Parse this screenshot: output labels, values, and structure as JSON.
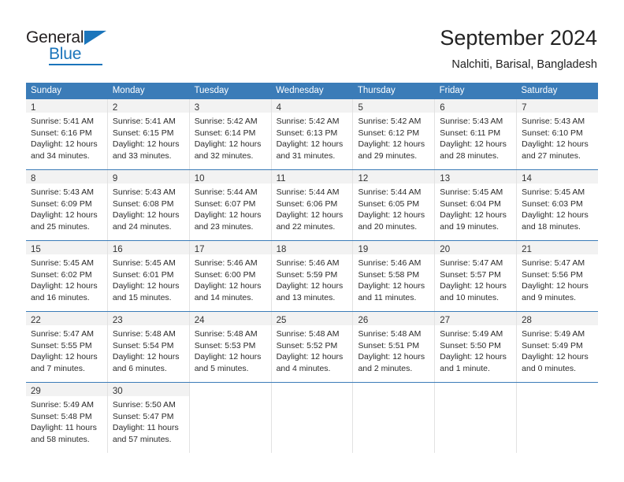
{
  "brand": {
    "name_part1": "General",
    "name_part2": "Blue"
  },
  "header": {
    "title": "September 2024",
    "location": "Nalchiti, Barisal, Bangladesh"
  },
  "weekdays": [
    "Sunday",
    "Monday",
    "Tuesday",
    "Wednesday",
    "Thursday",
    "Friday",
    "Saturday"
  ],
  "colors": {
    "header_blue": "#3b7cb8",
    "brand_blue": "#1b75bb",
    "daynum_band": "#f2f2f2",
    "cell_border": "#e2e2e2"
  },
  "weeks": [
    [
      {
        "day": "1",
        "sunrise": "Sunrise: 5:41 AM",
        "sunset": "Sunset: 6:16 PM",
        "daylight1": "Daylight: 12 hours",
        "daylight2": "and 34 minutes."
      },
      {
        "day": "2",
        "sunrise": "Sunrise: 5:41 AM",
        "sunset": "Sunset: 6:15 PM",
        "daylight1": "Daylight: 12 hours",
        "daylight2": "and 33 minutes."
      },
      {
        "day": "3",
        "sunrise": "Sunrise: 5:42 AM",
        "sunset": "Sunset: 6:14 PM",
        "daylight1": "Daylight: 12 hours",
        "daylight2": "and 32 minutes."
      },
      {
        "day": "4",
        "sunrise": "Sunrise: 5:42 AM",
        "sunset": "Sunset: 6:13 PM",
        "daylight1": "Daylight: 12 hours",
        "daylight2": "and 31 minutes."
      },
      {
        "day": "5",
        "sunrise": "Sunrise: 5:42 AM",
        "sunset": "Sunset: 6:12 PM",
        "daylight1": "Daylight: 12 hours",
        "daylight2": "and 29 minutes."
      },
      {
        "day": "6",
        "sunrise": "Sunrise: 5:43 AM",
        "sunset": "Sunset: 6:11 PM",
        "daylight1": "Daylight: 12 hours",
        "daylight2": "and 28 minutes."
      },
      {
        "day": "7",
        "sunrise": "Sunrise: 5:43 AM",
        "sunset": "Sunset: 6:10 PM",
        "daylight1": "Daylight: 12 hours",
        "daylight2": "and 27 minutes."
      }
    ],
    [
      {
        "day": "8",
        "sunrise": "Sunrise: 5:43 AM",
        "sunset": "Sunset: 6:09 PM",
        "daylight1": "Daylight: 12 hours",
        "daylight2": "and 25 minutes."
      },
      {
        "day": "9",
        "sunrise": "Sunrise: 5:43 AM",
        "sunset": "Sunset: 6:08 PM",
        "daylight1": "Daylight: 12 hours",
        "daylight2": "and 24 minutes."
      },
      {
        "day": "10",
        "sunrise": "Sunrise: 5:44 AM",
        "sunset": "Sunset: 6:07 PM",
        "daylight1": "Daylight: 12 hours",
        "daylight2": "and 23 minutes."
      },
      {
        "day": "11",
        "sunrise": "Sunrise: 5:44 AM",
        "sunset": "Sunset: 6:06 PM",
        "daylight1": "Daylight: 12 hours",
        "daylight2": "and 22 minutes."
      },
      {
        "day": "12",
        "sunrise": "Sunrise: 5:44 AM",
        "sunset": "Sunset: 6:05 PM",
        "daylight1": "Daylight: 12 hours",
        "daylight2": "and 20 minutes."
      },
      {
        "day": "13",
        "sunrise": "Sunrise: 5:45 AM",
        "sunset": "Sunset: 6:04 PM",
        "daylight1": "Daylight: 12 hours",
        "daylight2": "and 19 minutes."
      },
      {
        "day": "14",
        "sunrise": "Sunrise: 5:45 AM",
        "sunset": "Sunset: 6:03 PM",
        "daylight1": "Daylight: 12 hours",
        "daylight2": "and 18 minutes."
      }
    ],
    [
      {
        "day": "15",
        "sunrise": "Sunrise: 5:45 AM",
        "sunset": "Sunset: 6:02 PM",
        "daylight1": "Daylight: 12 hours",
        "daylight2": "and 16 minutes."
      },
      {
        "day": "16",
        "sunrise": "Sunrise: 5:45 AM",
        "sunset": "Sunset: 6:01 PM",
        "daylight1": "Daylight: 12 hours",
        "daylight2": "and 15 minutes."
      },
      {
        "day": "17",
        "sunrise": "Sunrise: 5:46 AM",
        "sunset": "Sunset: 6:00 PM",
        "daylight1": "Daylight: 12 hours",
        "daylight2": "and 14 minutes."
      },
      {
        "day": "18",
        "sunrise": "Sunrise: 5:46 AM",
        "sunset": "Sunset: 5:59 PM",
        "daylight1": "Daylight: 12 hours",
        "daylight2": "and 13 minutes."
      },
      {
        "day": "19",
        "sunrise": "Sunrise: 5:46 AM",
        "sunset": "Sunset: 5:58 PM",
        "daylight1": "Daylight: 12 hours",
        "daylight2": "and 11 minutes."
      },
      {
        "day": "20",
        "sunrise": "Sunrise: 5:47 AM",
        "sunset": "Sunset: 5:57 PM",
        "daylight1": "Daylight: 12 hours",
        "daylight2": "and 10 minutes."
      },
      {
        "day": "21",
        "sunrise": "Sunrise: 5:47 AM",
        "sunset": "Sunset: 5:56 PM",
        "daylight1": "Daylight: 12 hours",
        "daylight2": "and 9 minutes."
      }
    ],
    [
      {
        "day": "22",
        "sunrise": "Sunrise: 5:47 AM",
        "sunset": "Sunset: 5:55 PM",
        "daylight1": "Daylight: 12 hours",
        "daylight2": "and 7 minutes."
      },
      {
        "day": "23",
        "sunrise": "Sunrise: 5:48 AM",
        "sunset": "Sunset: 5:54 PM",
        "daylight1": "Daylight: 12 hours",
        "daylight2": "and 6 minutes."
      },
      {
        "day": "24",
        "sunrise": "Sunrise: 5:48 AM",
        "sunset": "Sunset: 5:53 PM",
        "daylight1": "Daylight: 12 hours",
        "daylight2": "and 5 minutes."
      },
      {
        "day": "25",
        "sunrise": "Sunrise: 5:48 AM",
        "sunset": "Sunset: 5:52 PM",
        "daylight1": "Daylight: 12 hours",
        "daylight2": "and 4 minutes."
      },
      {
        "day": "26",
        "sunrise": "Sunrise: 5:48 AM",
        "sunset": "Sunset: 5:51 PM",
        "daylight1": "Daylight: 12 hours",
        "daylight2": "and 2 minutes."
      },
      {
        "day": "27",
        "sunrise": "Sunrise: 5:49 AM",
        "sunset": "Sunset: 5:50 PM",
        "daylight1": "Daylight: 12 hours",
        "daylight2": "and 1 minute."
      },
      {
        "day": "28",
        "sunrise": "Sunrise: 5:49 AM",
        "sunset": "Sunset: 5:49 PM",
        "daylight1": "Daylight: 12 hours",
        "daylight2": "and 0 minutes."
      }
    ],
    [
      {
        "day": "29",
        "sunrise": "Sunrise: 5:49 AM",
        "sunset": "Sunset: 5:48 PM",
        "daylight1": "Daylight: 11 hours",
        "daylight2": "and 58 minutes."
      },
      {
        "day": "30",
        "sunrise": "Sunrise: 5:50 AM",
        "sunset": "Sunset: 5:47 PM",
        "daylight1": "Daylight: 11 hours",
        "daylight2": "and 57 minutes."
      },
      {
        "day": "",
        "sunrise": "",
        "sunset": "",
        "daylight1": "",
        "daylight2": ""
      },
      {
        "day": "",
        "sunrise": "",
        "sunset": "",
        "daylight1": "",
        "daylight2": ""
      },
      {
        "day": "",
        "sunrise": "",
        "sunset": "",
        "daylight1": "",
        "daylight2": ""
      },
      {
        "day": "",
        "sunrise": "",
        "sunset": "",
        "daylight1": "",
        "daylight2": ""
      },
      {
        "day": "",
        "sunrise": "",
        "sunset": "",
        "daylight1": "",
        "daylight2": ""
      }
    ]
  ]
}
